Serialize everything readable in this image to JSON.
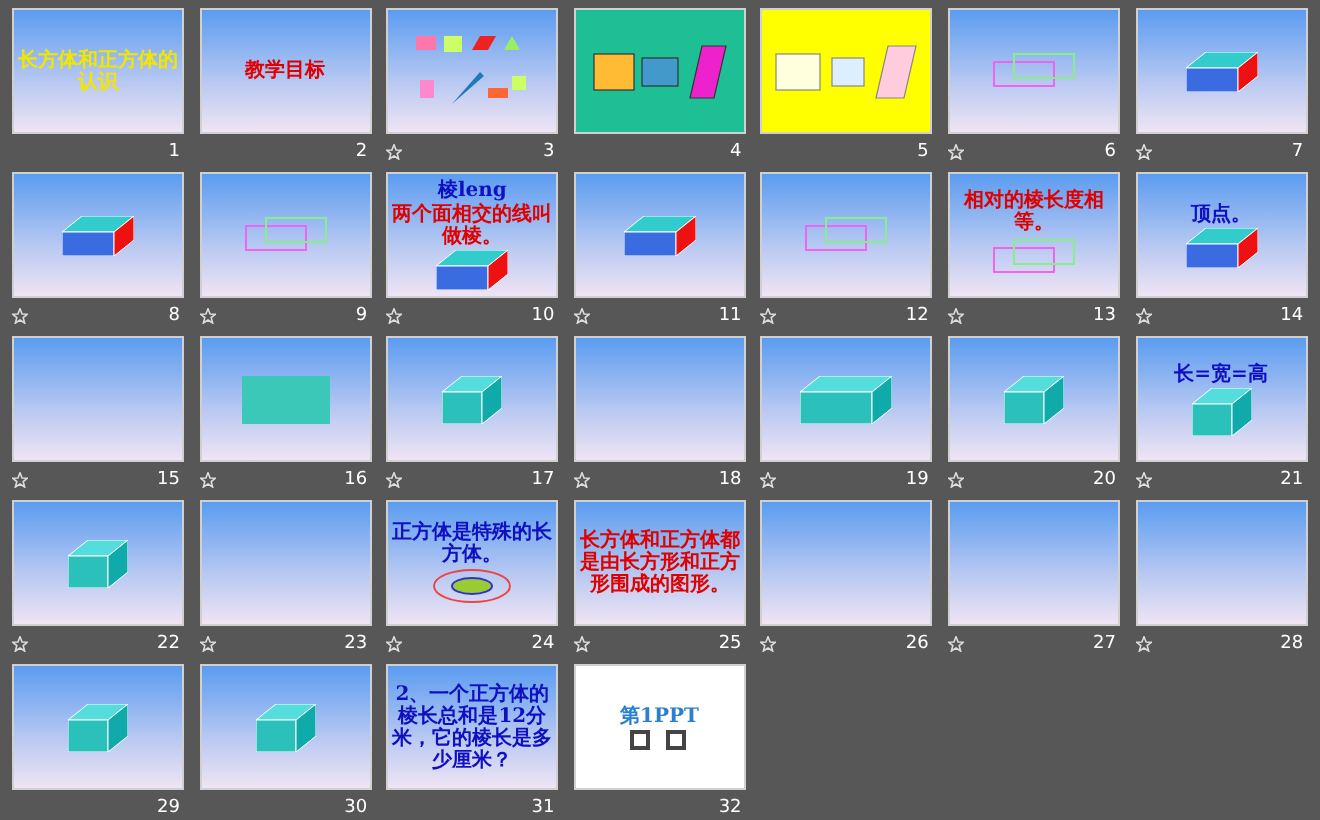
{
  "slides": [
    {
      "number": "1",
      "animated": false,
      "kind": "gradient",
      "texts": [
        {
          "text": "长方体和正方体的认识",
          "color": "#f2e600"
        }
      ]
    },
    {
      "number": "2",
      "animated": false,
      "kind": "gradient",
      "texts": [
        {
          "text": "教学目标",
          "color": "#e00000"
        }
      ]
    },
    {
      "number": "3",
      "animated": true,
      "kind": "gradient"
    },
    {
      "number": "4",
      "animated": false,
      "kind": "green"
    },
    {
      "number": "5",
      "animated": false,
      "kind": "yellow"
    },
    {
      "number": "6",
      "animated": true,
      "kind": "gradient"
    },
    {
      "number": "7",
      "animated": true,
      "kind": "gradient"
    },
    {
      "number": "8",
      "animated": true,
      "kind": "gradient"
    },
    {
      "number": "9",
      "animated": true,
      "kind": "gradient"
    },
    {
      "number": "10",
      "animated": true,
      "kind": "gradient",
      "texts": [
        {
          "text": "棱leng",
          "color": "#1010c0"
        },
        {
          "text": "两个面相交的线叫做棱。",
          "color": "#e00000"
        }
      ]
    },
    {
      "number": "11",
      "animated": true,
      "kind": "gradient"
    },
    {
      "number": "12",
      "animated": true,
      "kind": "gradient"
    },
    {
      "number": "13",
      "animated": true,
      "kind": "gradient",
      "texts": [
        {
          "text": "相对的棱长度相等。",
          "color": "#e00000"
        }
      ]
    },
    {
      "number": "14",
      "animated": true,
      "kind": "gradient",
      "texts": [
        {
          "text": "顶点。",
          "color": "#1010c0"
        }
      ]
    },
    {
      "number": "15",
      "animated": true,
      "kind": "gradient"
    },
    {
      "number": "16",
      "animated": true,
      "kind": "gradient"
    },
    {
      "number": "17",
      "animated": true,
      "kind": "gradient"
    },
    {
      "number": "18",
      "animated": true,
      "kind": "gradient"
    },
    {
      "number": "19",
      "animated": true,
      "kind": "gradient"
    },
    {
      "number": "20",
      "animated": true,
      "kind": "gradient"
    },
    {
      "number": "21",
      "animated": true,
      "kind": "gradient",
      "texts": [
        {
          "text": "长=宽=高",
          "color": "#1010c0"
        }
      ]
    },
    {
      "number": "22",
      "animated": true,
      "kind": "gradient"
    },
    {
      "number": "23",
      "animated": true,
      "kind": "gradient"
    },
    {
      "number": "24",
      "animated": true,
      "kind": "gradient",
      "texts": [
        {
          "text": "正方体是特殊的长方体。",
          "color": "#1010c0"
        }
      ]
    },
    {
      "number": "25",
      "animated": true,
      "kind": "gradient",
      "texts": [
        {
          "text": "长方体和正方体都是由长方形和正方形围成的图形。",
          "color": "#e00000"
        }
      ]
    },
    {
      "number": "26",
      "animated": true,
      "kind": "gradient"
    },
    {
      "number": "27",
      "animated": true,
      "kind": "gradient"
    },
    {
      "number": "28",
      "animated": true,
      "kind": "gradient"
    },
    {
      "number": "29",
      "animated": false,
      "kind": "gradient"
    },
    {
      "number": "30",
      "animated": false,
      "kind": "gradient"
    },
    {
      "number": "31",
      "animated": false,
      "kind": "gradient",
      "texts": [
        {
          "text": "2、一个正方体的棱长总和是12分米，它的棱长是多少厘米？",
          "color": "#1010c0"
        }
      ]
    },
    {
      "number": "32",
      "animated": false,
      "kind": "white",
      "texts": [
        {
          "text": "第1PPT",
          "color": "#2a7fd0"
        }
      ]
    }
  ]
}
